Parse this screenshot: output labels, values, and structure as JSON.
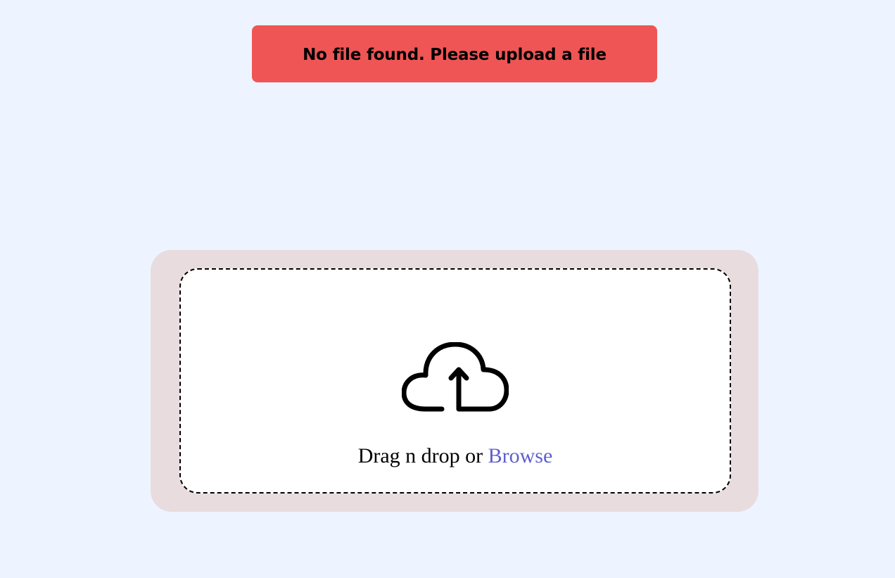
{
  "alert": {
    "message": "No file found. Please upload a file",
    "color": "#ef5555"
  },
  "upload": {
    "icon": "cloud-upload-icon",
    "drop_text": "Drag n drop or",
    "browse_label": "Browse",
    "browse_color": "#5f5fcd",
    "panel_color": "#e8dcde",
    "background_color": "#edf4ff"
  }
}
